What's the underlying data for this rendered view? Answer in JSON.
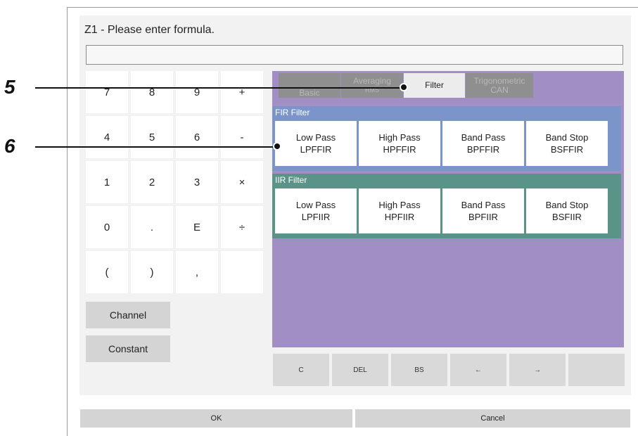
{
  "dialog": {
    "title": "Z1 - Please enter formula.",
    "formula_value": ""
  },
  "keypad": {
    "keys": [
      "7",
      "8",
      "9",
      "+",
      "4",
      "5",
      "6",
      "-",
      "1",
      "2",
      "3",
      "×",
      "0",
      ".",
      "E",
      "÷",
      "(",
      ")",
      ",",
      ""
    ]
  },
  "side_buttons": {
    "channel": "Channel",
    "constant": "Constant"
  },
  "function_tabs": [
    {
      "line1": "Basic",
      "line2": ""
    },
    {
      "line1": "Averaging",
      "line2": "RMS"
    },
    {
      "line1": "Filter",
      "line2": ""
    },
    {
      "line1": "Trigonometric",
      "line2": "CAN"
    }
  ],
  "active_tab": "Filter",
  "fir_group": {
    "title": "FIR Filter",
    "color": "#7b95ca",
    "buttons": [
      {
        "name": "Low Pass",
        "code": "LPFFIR"
      },
      {
        "name": "High Pass",
        "code": "HPFFIR"
      },
      {
        "name": "Band Pass",
        "code": "BPFFIR"
      },
      {
        "name": "Band Stop",
        "code": "BSFFIR"
      }
    ]
  },
  "iir_group": {
    "title": "IIR Filter",
    "color": "#5a9387",
    "buttons": [
      {
        "name": "Low Pass",
        "code": "LPFIIR"
      },
      {
        "name": "High Pass",
        "code": "HPFIIR"
      },
      {
        "name": "Band Pass",
        "code": "BPFIIR"
      },
      {
        "name": "Band Stop",
        "code": "BSFIIR"
      }
    ]
  },
  "edit_buttons": [
    "C",
    "DEL",
    "BS",
    "←",
    "→",
    ""
  ],
  "footer": {
    "ok": "OK",
    "cancel": "Cancel"
  },
  "callouts": {
    "first": "5",
    "second": "6"
  },
  "colors": {
    "panel": "#a18ec4",
    "tab_active": "#ececec",
    "tab_inactive": "#8f8f8f"
  }
}
